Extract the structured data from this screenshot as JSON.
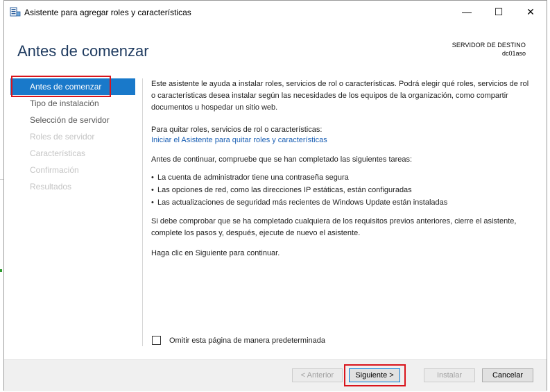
{
  "window": {
    "title": "Asistente para agregar roles y características",
    "minimize_symbol": "—",
    "maximize_symbol": "☐",
    "close_symbol": "✕"
  },
  "header": {
    "title": "Antes de comenzar",
    "destination_label": "SERVIDOR DE DESTINO",
    "destination_server": "dc01aso"
  },
  "nav": {
    "items": [
      {
        "label": "Antes de comenzar",
        "state": "active"
      },
      {
        "label": "Tipo de instalación",
        "state": "enabled"
      },
      {
        "label": "Selección de servidor",
        "state": "enabled"
      },
      {
        "label": "Roles de servidor",
        "state": "disabled"
      },
      {
        "label": "Características",
        "state": "disabled"
      },
      {
        "label": "Confirmación",
        "state": "disabled"
      },
      {
        "label": "Resultados",
        "state": "disabled"
      }
    ]
  },
  "content": {
    "intro": "Este asistente le ayuda a instalar roles, servicios de rol o características. Podrá elegir qué roles, servicios de rol o características desea instalar según las necesidades de los equipos de la organización, como compartir documentos u hospedar un sitio web.",
    "remove_heading": "Para quitar roles, servicios de rol o características:",
    "remove_link": "Iniciar el Asistente para quitar roles y características",
    "check_heading": "Antes de continuar, compruebe que se han completado las siguientes tareas:",
    "bullet_symbol": "•",
    "tasks": [
      "La cuenta de administrador tiene una contraseña segura",
      "Las opciones de red, como las direcciones IP estáticas, están configuradas",
      "Las actualizaciones de seguridad más recientes de Windows Update están instaladas"
    ],
    "verify_text": "Si debe comprobar que se ha completado cualquiera de los requisitos previos anteriores, cierre el asistente, complete los pasos y, después, ejecute de nuevo el asistente.",
    "continue_text": "Haga clic en Siguiente para continuar."
  },
  "skip_checkbox": {
    "label": "Omitir esta página de manera predeterminada",
    "checked": false
  },
  "buttons": {
    "previous": "< Anterior",
    "next": "Siguiente >",
    "install": "Instalar",
    "cancel": "Cancelar"
  },
  "colors": {
    "accent": "#1979ca",
    "highlight": "#d9141c",
    "link": "#1a5fb4"
  }
}
